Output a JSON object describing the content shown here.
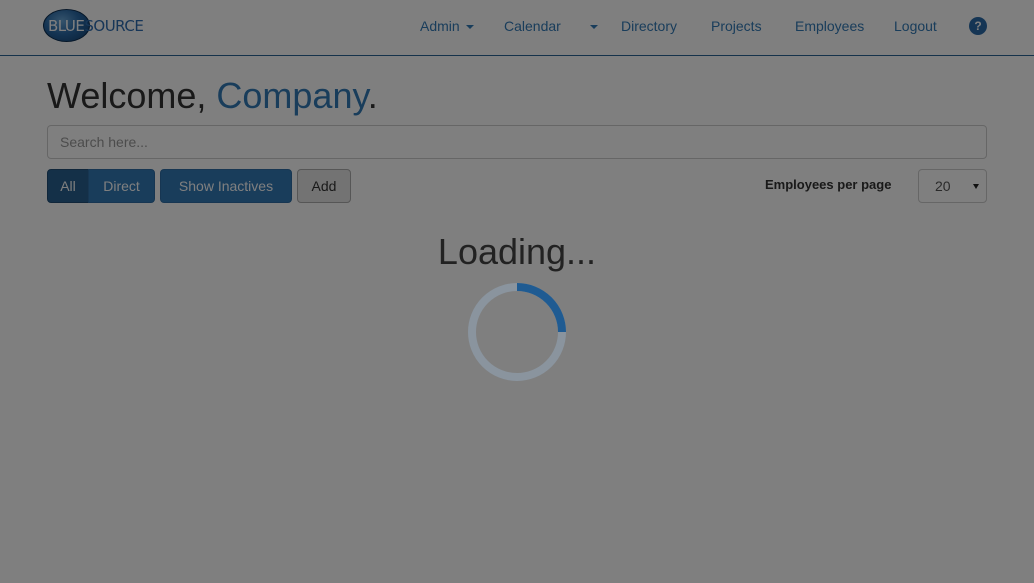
{
  "navbar": {
    "logo": {
      "part1": "BLUE",
      "part2": "SOURCE"
    },
    "items": [
      {
        "label": "Admin",
        "has_caret": true
      },
      {
        "label": "Calendar",
        "has_caret": true
      },
      {
        "label": "Directory"
      },
      {
        "label": "Projects"
      },
      {
        "label": "Employees"
      },
      {
        "label": "Logout"
      }
    ],
    "help_icon": {
      "glyph": "?",
      "icon": "question-circle-icon"
    }
  },
  "welcome": {
    "greeting": "Welcome, ",
    "name": "Company",
    "punctuation": "."
  },
  "search": {
    "placeholder": "Search here...",
    "value": ""
  },
  "filters": {
    "all_label": "All",
    "direct_label": "Direct",
    "show_inactives_label": "Show Inactives",
    "add_label": "Add",
    "active_filter": "All"
  },
  "pagination": {
    "per_page_label": "Employees per page",
    "per_page_value": "20"
  },
  "loading": {
    "text": "Loading..."
  },
  "colors": {
    "accent": "#337ab7",
    "overlay": "rgba(0,0,0,0.5)"
  }
}
